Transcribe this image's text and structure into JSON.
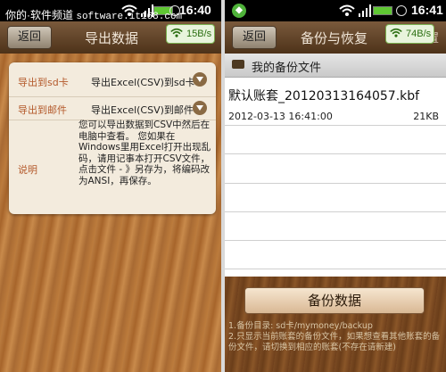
{
  "watermark": {
    "text": "你的·软件频道",
    "domain": "software.it168.com"
  },
  "status_left": {
    "time": "16:40"
  },
  "status_right": {
    "time": "16:41"
  },
  "left_screen": {
    "back_label": "返回",
    "title": "导出数据",
    "speed_badge": "15B/s",
    "rows": [
      {
        "label": "导出到sd卡",
        "value": "导出Excel(CSV)到sd卡"
      },
      {
        "label": "导出到邮件",
        "value": "导出Excel(CSV)到邮件"
      },
      {
        "label": "说明",
        "value": "您可以导出数据到CSV中然后在电脑中查看。 您如果在Windows里用Excel打开出现乱码，请用记事本打开CSV文件，点击文件 - 》另存为，将编码改为ANSI，再保存。"
      }
    ]
  },
  "right_screen": {
    "back_label": "返回",
    "title": "备份与恢复",
    "speed_badge": "74B/s",
    "settings_peek": "设置",
    "section_title": "我的备份文件",
    "file": {
      "name": "默认账套_20120313164057.kbf",
      "date": "2012-03-13 16:41:00",
      "size": "21KB"
    },
    "backup_button": "备份数据",
    "notes": "1.备份目录: sd卡/mymoney/backup\n2.只显示当前账套的备份文件，如果想查看其他账套的备份文件，请切换到相应的账套(不存在请新建)"
  },
  "colors": {
    "accent_label": "#b45a2c",
    "titlebar": "#5c3d22",
    "status_bar": "#000000"
  }
}
